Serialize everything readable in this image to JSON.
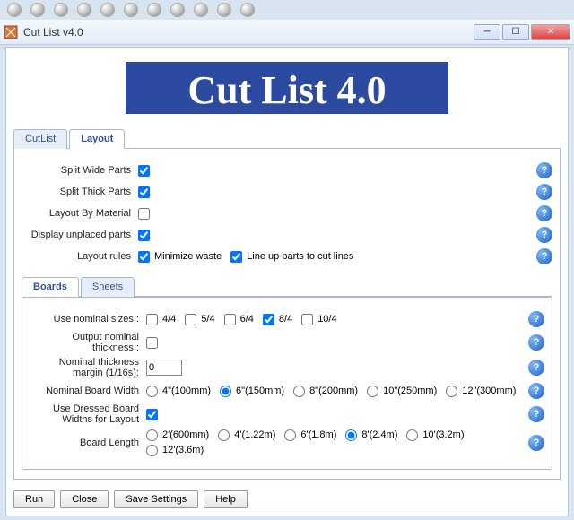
{
  "window": {
    "title": "Cut List v4.0"
  },
  "logo_text": "Cut List 4.0",
  "tabs": {
    "cutlist": "CutList",
    "layout": "Layout"
  },
  "layout": {
    "split_wide": {
      "label": "Split Wide Parts",
      "checked": true
    },
    "split_thick": {
      "label": "Split Thick Parts",
      "checked": true
    },
    "by_material": {
      "label": "Layout By Material",
      "checked": false
    },
    "display_unplaced": {
      "label": "Display unplaced parts",
      "checked": true
    },
    "rules": {
      "label": "Layout rules",
      "minimize": {
        "label": "Minimize waste",
        "checked": true
      },
      "lineup": {
        "label": "Line up parts to cut lines",
        "checked": true
      }
    }
  },
  "subtabs": {
    "boards": "Boards",
    "sheets": "Sheets"
  },
  "boards": {
    "nominal_sizes": {
      "label": "Use nominal sizes :",
      "opts": [
        {
          "t": "4/4",
          "c": false
        },
        {
          "t": "5/4",
          "c": false
        },
        {
          "t": "6/4",
          "c": false
        },
        {
          "t": "8/4",
          "c": true
        },
        {
          "t": "10/4",
          "c": false
        }
      ]
    },
    "output_nominal": {
      "label": "Output nominal thickness :",
      "checked": false
    },
    "margin": {
      "label": "Nominal thickness margin (1/16s):",
      "value": "0"
    },
    "width": {
      "label": "Nominal Board Width",
      "opts": [
        {
          "t": "4\"(100mm)",
          "c": false
        },
        {
          "t": "6\"(150mm)",
          "c": true
        },
        {
          "t": "8\"(200mm)",
          "c": false
        },
        {
          "t": "10\"(250mm)",
          "c": false
        },
        {
          "t": "12\"(300mm)",
          "c": false
        }
      ]
    },
    "dressed": {
      "label": "Use Dressed Board Widths for Layout",
      "checked": true
    },
    "length": {
      "label": "Board Length",
      "opts": [
        {
          "t": "2'(600mm)",
          "c": false
        },
        {
          "t": "4'(1.22m)",
          "c": false
        },
        {
          "t": "6'(1.8m)",
          "c": false
        },
        {
          "t": "8'(2.4m)",
          "c": true
        },
        {
          "t": "10'(3.2m)",
          "c": false
        },
        {
          "t": "12'(3.6m)",
          "c": false
        }
      ]
    }
  },
  "buttons": {
    "run": "Run",
    "close": "Close",
    "save": "Save Settings",
    "help": "Help"
  }
}
